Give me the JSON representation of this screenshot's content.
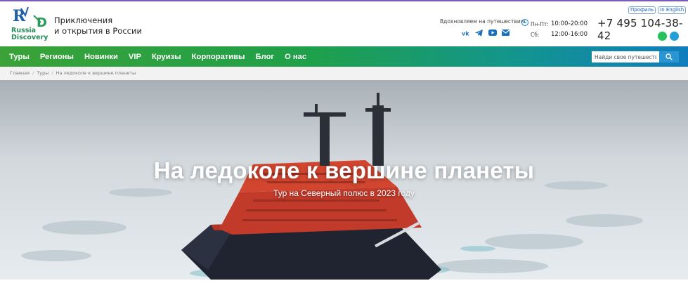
{
  "header": {
    "logo_text_line1": "Russia",
    "logo_text_line2": "Discovery",
    "tagline_line1": "Приключения",
    "tagline_line2": "и открытия в России",
    "inspire": "Вдохновляем на путешествия",
    "socials": [
      "vk-icon",
      "telegram-icon",
      "youtube-icon",
      "mail-icon"
    ],
    "hours": [
      {
        "days": "Пн-Пт:",
        "time": "10:00-20:00"
      },
      {
        "days": "Сб:",
        "time": "12:00-16:00"
      }
    ],
    "profile_link": "Профиль",
    "english_link": "In English",
    "phone": "+7 495 104-38-42",
    "messengers": [
      "whatsapp-icon",
      "telegram-icon"
    ]
  },
  "nav": {
    "items": [
      "Туры",
      "Регионы",
      "Новинки",
      "VIP",
      "Круизы",
      "Корпоративы",
      "Блог",
      "О нас"
    ],
    "search_placeholder": "Найди свое путешествие"
  },
  "breadcrumb": [
    "Главная",
    "Туры",
    "На ледоколе к вершине планеты"
  ],
  "hero": {
    "title": "На ледоколе к вершине планеты",
    "subtitle": "Тур на Северный полюс в 2023 году"
  },
  "colors": {
    "nav_start": "#3aa237",
    "nav_end": "#0f7dbd",
    "ship_hull": "#1f2430",
    "ship_superstructure": "#c23a2a"
  }
}
